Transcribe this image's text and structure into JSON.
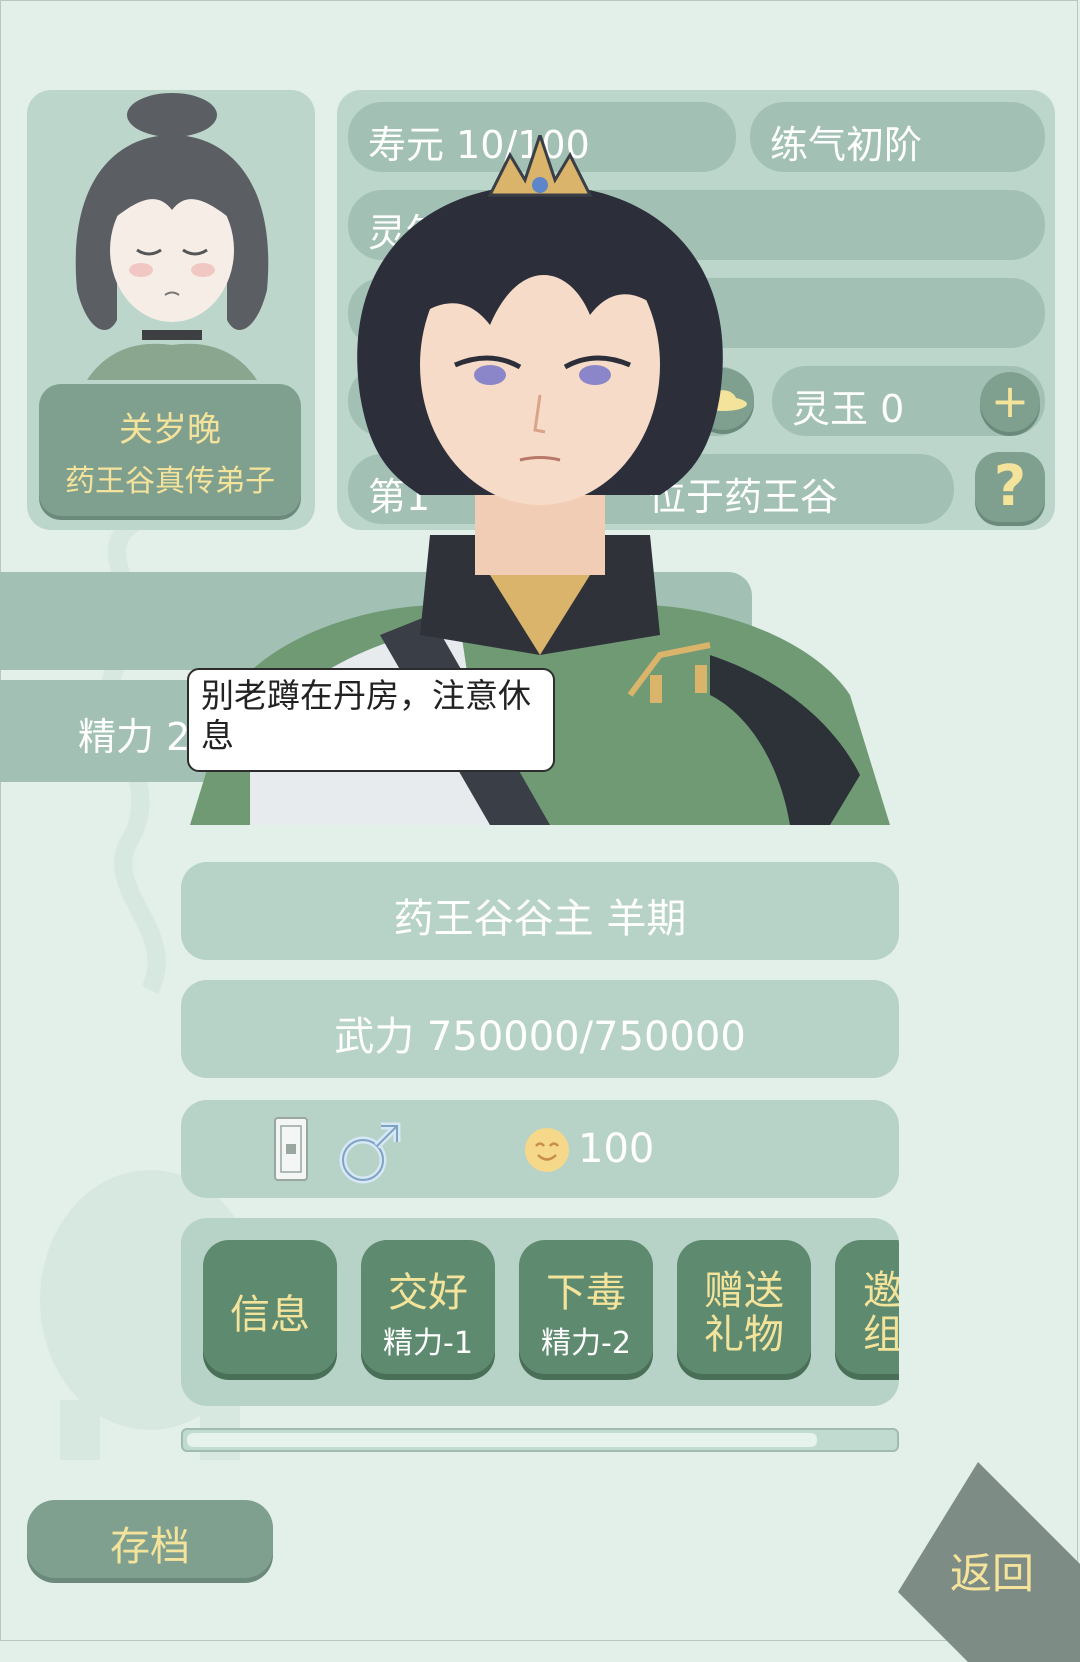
{
  "player": {
    "name": "关岁晚",
    "title": "药王谷真传弟子"
  },
  "stats": {
    "lifespan": "寿元 10/100",
    "realm": "练气初阶",
    "spirit_label": "灵气",
    "row3_label": "",
    "row4_label": "",
    "spirit_jade": "灵玉 0",
    "add_symbol": "+",
    "location_prefix": "第1",
    "location_suffix": "位于药王谷",
    "help_symbol": "?"
  },
  "side_tabs": {
    "energy": "精力 2"
  },
  "dialogue": {
    "text": "别老蹲在丹房，注意休息"
  },
  "npc": {
    "title_name": "药王谷谷主 羊期",
    "power": "武力 750000/750000",
    "favor": "100"
  },
  "actions": [
    {
      "label": "信息",
      "cost": ""
    },
    {
      "label": "交好",
      "cost": "精力-1"
    },
    {
      "label": "下毒",
      "cost": "精力-2"
    },
    {
      "label": "赠送",
      "cost": "礼物"
    },
    {
      "label": "邀",
      "cost": "组"
    }
  ],
  "footer": {
    "save": "存档",
    "back": "返回"
  },
  "colors": {
    "panel": "#bcd6cb",
    "pill": "#a2c1b4",
    "button_dark": "#5e8a6f",
    "gold_text": "#f4e39b"
  }
}
